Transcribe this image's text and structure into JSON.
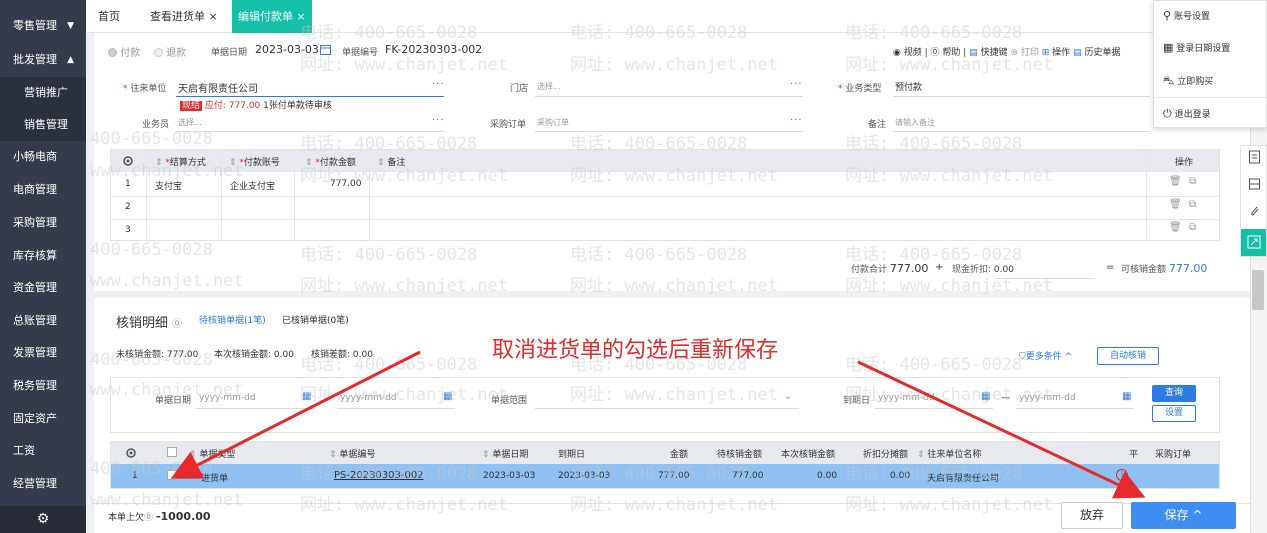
{
  "sidebar": {
    "items": [
      {
        "label": "零售管理",
        "caret": "▼"
      },
      {
        "label": "批发管理",
        "caret": "▲"
      },
      {
        "label": "营销推广"
      },
      {
        "label": "销售管理"
      },
      {
        "label": "小畅电商"
      },
      {
        "label": "电商管理"
      },
      {
        "label": "采购管理"
      },
      {
        "label": "库存核算"
      },
      {
        "label": "资金管理"
      },
      {
        "label": "总账管理"
      },
      {
        "label": "发票管理"
      },
      {
        "label": "税务管理"
      },
      {
        "label": "固定资产"
      },
      {
        "label": "工资"
      },
      {
        "label": "经营管理"
      }
    ],
    "gear_icon": "⚙"
  },
  "tabs": [
    {
      "label": "首页"
    },
    {
      "label": "查看进货单",
      "close": "×"
    },
    {
      "label": "编辑付款单",
      "close": "×"
    }
  ],
  "user_menu": {
    "items": [
      {
        "label": "账号设置",
        "icon": "user-key-icon"
      },
      {
        "label": "登录日期设置",
        "icon": "calendar-icon"
      },
      {
        "label": "立即购买",
        "icon": "cart-icon"
      },
      {
        "label": "退出登录",
        "icon": "power-icon"
      }
    ]
  },
  "header": {
    "radio_pay": "付款",
    "radio_refund": "退款",
    "date_label": "单据日期",
    "date_value": "2023-03-03",
    "no_label": "单据编号",
    "no_value": "FK-20230303-002",
    "toolbar": {
      "video": "视频",
      "help": "帮助",
      "shortcut": "快捷键",
      "print": "打印",
      "ops": "操作",
      "history": "历史单据"
    }
  },
  "form": {
    "partner_label": "往来单位",
    "partner_value": "天启有限责任公司",
    "badge": "现结",
    "payable": "应付: 777.00",
    "pending": "1张付单款待审核",
    "store_label": "门店",
    "store_placeholder": "选择...",
    "biztype_label": "业务类型",
    "biztype_value": "预付款",
    "clerk_label": "业务员",
    "clerk_placeholder": "选择...",
    "po_label": "采购订单",
    "po_placeholder": "采购订单",
    "remark_label": "备注",
    "remark_placeholder": "请输入备注"
  },
  "pay_table": {
    "headers": [
      "结算方式",
      "付款账号",
      "付款金额",
      "备注",
      "操作"
    ],
    "rows": [
      {
        "no": "1",
        "method": "支付宝",
        "account": "企业支付宝",
        "amount": "777.00"
      },
      {
        "no": "2",
        "method": "",
        "account": "",
        "amount": ""
      },
      {
        "no": "3",
        "method": "",
        "account": "",
        "amount": ""
      }
    ]
  },
  "totals": {
    "pay_total_label": "付款合计",
    "pay_total": "777.00",
    "plus": "+",
    "discount_label": "现金折扣:",
    "discount": "0.00",
    "eq": "=",
    "writeoff_label": "可核销金额",
    "writeoff": "777.00"
  },
  "writeoff": {
    "title": "核销明细",
    "tab_pending": "待核销单据(1笔)",
    "tab_done": "已核销单据(0笔)",
    "unverified": "未核销金额: 777.00",
    "this_time": "本次核销金额: 0.00",
    "diff": "核销差额: 0.00",
    "more": "更多条件",
    "auto": "自动核销",
    "filter_date_label": "单据日期",
    "date_ph": "yyyy-mm-dd",
    "range_label": "单据范围",
    "due_label": "到期日",
    "dash": "—",
    "query": "查询",
    "settings": "设置"
  },
  "annotation": "取消进货单的勾选后重新保存",
  "doc_table": {
    "headers": [
      "单据类型",
      "单据编号",
      "单据日期",
      "到期日",
      "金额",
      "待核销金额",
      "本次核销金额",
      "折扣分摊额",
      "往来单位名称",
      "平",
      "采购订单"
    ],
    "row": {
      "no": "1",
      "type": "进货单",
      "code": "PS-20230303-002",
      "date": "2023-03-03",
      "due": "2023-03-03",
      "amount": "777.00",
      "pending": "777.00",
      "this_time": "0.00",
      "discount": "0.00",
      "partner": "天启有限责任公司",
      "flag": "!"
    }
  },
  "footer": {
    "prev_debt_label": "本单上欠",
    "prev_debt": "-1000.00",
    "abandon": "放弃",
    "save": "保存",
    "save_caret": "^"
  },
  "watermark": {
    "phone": "电话: 400-665-0028",
    "site": "网址: www.chanjet.net",
    "phone_short": "400-665-0028",
    "site_short": "www.chanjet.net"
  },
  "colors": {
    "accent": "#15c0a8",
    "primary": "#2d7be5",
    "sidebar": "#353b4a",
    "annotation": "#e42a2a"
  }
}
